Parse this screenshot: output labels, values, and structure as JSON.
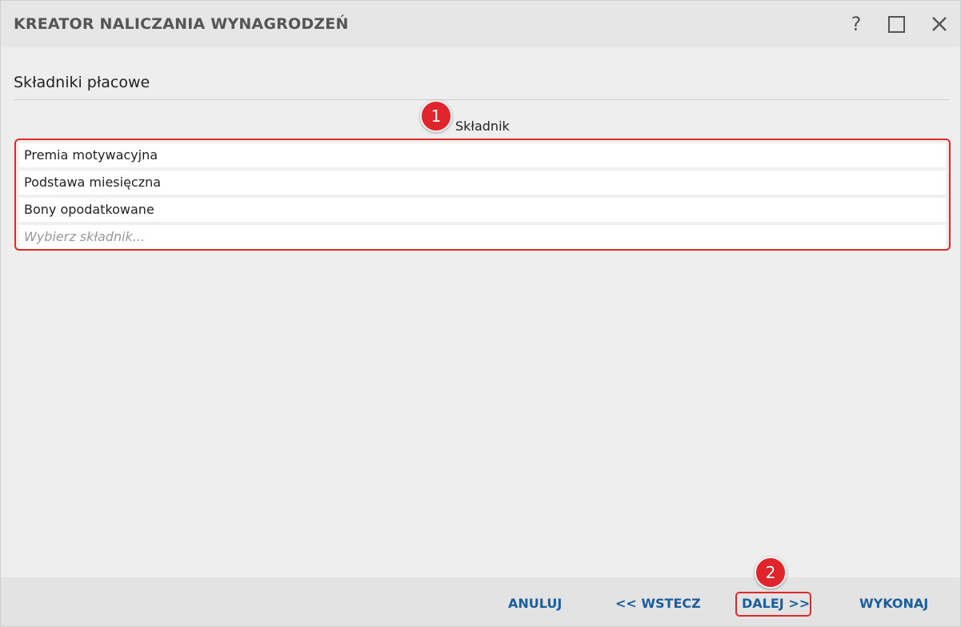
{
  "window": {
    "title": "KREATOR NALICZANIA WYNAGRODZEŃ",
    "help_label": "?",
    "maximize_icon": "maximize-icon",
    "close_icon": "close-icon"
  },
  "section": {
    "title": "Składniki płacowe"
  },
  "list": {
    "column_header": "Składnik",
    "items": [
      "Premia motywacyjna",
      "Podstawa miesięczna",
      "Bony opodatkowane"
    ],
    "placeholder": "Wybierz składnik..."
  },
  "annotations": {
    "badge1": "1",
    "badge2": "2",
    "highlight_color": "#e02a2a"
  },
  "footer": {
    "cancel_label": "ANULUJ",
    "back_label": "<< WSTECZ",
    "next_label": "DALEJ >>",
    "execute_label": "WYKONAJ",
    "button_color": "#1a5e9e"
  }
}
